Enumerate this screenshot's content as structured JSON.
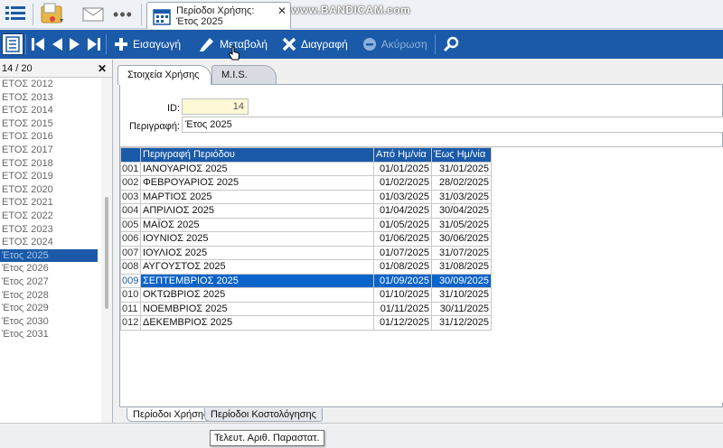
{
  "window": {
    "tab_title_line1": "Περίοδοι Χρήσης:",
    "tab_title_line2": "Έτος 2025",
    "watermark": "www.BANDICAM.com",
    "more_label": "•••"
  },
  "toolbar": {
    "insert_label": "Εισαγωγή",
    "edit_label": "Μεταβολή",
    "delete_label": "Διαγραφή",
    "cancel_label": "Ακύρωση"
  },
  "left": {
    "counter": "14 / 20",
    "years": [
      "ΕΤΟΣ 2012",
      "ΕΤΟΣ 2013",
      "ΕΤΟΣ 2014",
      "ΕΤΟΣ 2015",
      "ΕΤΟΣ 2016",
      "ΕΤΟΣ 2017",
      "ΕΤΟΣ 2018",
      "ΕΤΟΣ 2019",
      "ΕΤΟΣ 2020",
      "ΕΤΟΣ 2021",
      "ΕΤΟΣ 2022",
      "ΕΤΟΣ 2023",
      "ΕΤΟΣ 2024",
      "Έτος 2025",
      "Έτος 2026",
      "Έτος 2027",
      "Έτος 2028",
      "Έτος 2029",
      "Έτος 2030",
      "Έτος 2031"
    ],
    "selected_index": 13
  },
  "tabs": {
    "stoixeia": "Στοιχεία Χρήσης",
    "mis": "M.I.S."
  },
  "form": {
    "id_label": "ID:",
    "id_value": "14",
    "desc_label": "Περιγραφή:",
    "desc_value": "Έτος 2025"
  },
  "grid": {
    "columns": [
      "Περιγραφή Περιόδου",
      "Από Ημ/νία",
      "Έως Ημ/νία"
    ],
    "rows": [
      {
        "code": "001",
        "desc": "ΙΑΝΟΥΑΡΙΟΣ 2025",
        "from": "01/01/2025",
        "to": "31/01/2025"
      },
      {
        "code": "002",
        "desc": "ΦΕΒΡΟΥΑΡΙΟΣ 2025",
        "from": "01/02/2025",
        "to": "28/02/2025"
      },
      {
        "code": "003",
        "desc": "ΜΑΡΤΙΟΣ 2025",
        "from": "01/03/2025",
        "to": "31/03/2025"
      },
      {
        "code": "004",
        "desc": "ΑΠΡΙΛΙΟΣ 2025",
        "from": "01/04/2025",
        "to": "30/04/2025"
      },
      {
        "code": "005",
        "desc": "ΜΑΪΟΣ 2025",
        "from": "01/05/2025",
        "to": "31/05/2025"
      },
      {
        "code": "006",
        "desc": "ΙΟΥΝΙΟΣ 2025",
        "from": "01/06/2025",
        "to": "30/06/2025"
      },
      {
        "code": "007",
        "desc": "ΙΟΥΛΙΟΣ 2025",
        "from": "01/07/2025",
        "to": "31/07/2025"
      },
      {
        "code": "008",
        "desc": "ΑΥΓΟΥΣΤΟΣ 2025",
        "from": "01/08/2025",
        "to": "31/08/2025"
      },
      {
        "code": "009",
        "desc": "ΣΕΠΤΕΜΒΡΙΟΣ 2025",
        "from": "01/09/2025",
        "to": "30/09/2025"
      },
      {
        "code": "010",
        "desc": "ΟΚΤΩΒΡΙΟΣ 2025",
        "from": "01/10/2025",
        "to": "31/10/2025"
      },
      {
        "code": "011",
        "desc": "ΝΟΕΜΒΡΙΟΣ 2025",
        "from": "01/11/2025",
        "to": "30/11/2025"
      },
      {
        "code": "012",
        "desc": "ΔΕΚΕΜΒΡΙΟΣ 2025",
        "from": "01/12/2025",
        "to": "31/12/2025"
      }
    ],
    "selected_index": 8
  },
  "bottom_tabs": {
    "xrisis": "Περίοδοι Χρήσης",
    "kostol": "Περίοδοι Κοστολόγησης"
  },
  "status": {
    "tooltip": "Τελευτ. Αριθ. Παραστατ."
  },
  "colors": {
    "toolbar_bg": "#1a5aa8",
    "selection": "#0a63c9",
    "id_field_bg": "#fdf8d5"
  }
}
